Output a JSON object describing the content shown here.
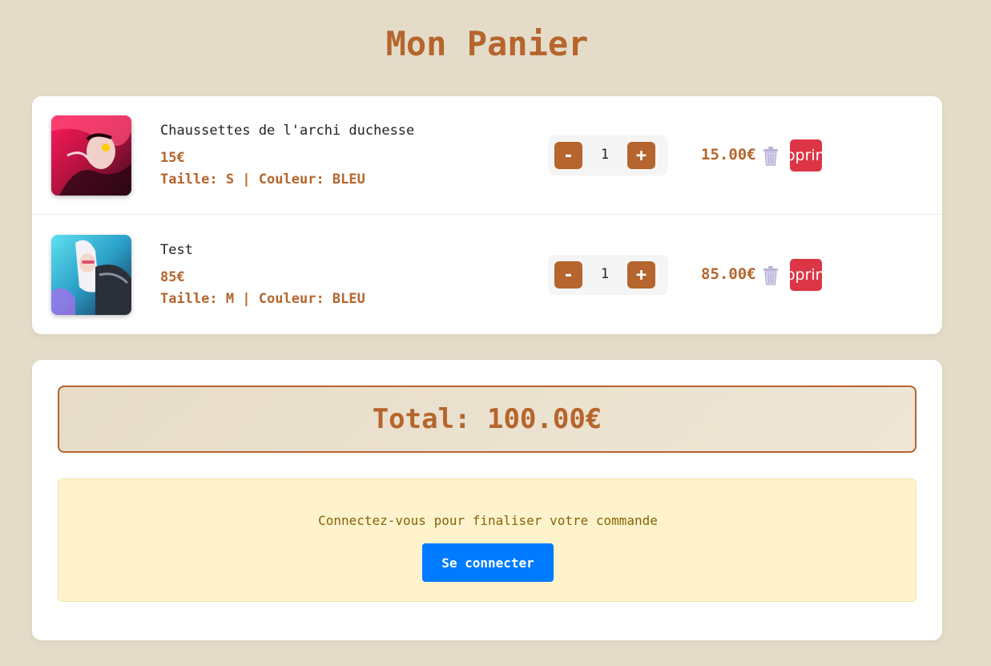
{
  "page": {
    "title": "Mon Panier"
  },
  "cart": {
    "items": [
      {
        "name": "Chaussettes de l'archi duchesse",
        "price": "15€",
        "variant": "Taille: S | Couleur: BLEU",
        "qty": "1",
        "minus_label": "-",
        "plus_label": "+",
        "line_total": "15.00€",
        "remove_label": "Supprimer",
        "image_icon": "product-image-red"
      },
      {
        "name": "Test",
        "price": "85€",
        "variant": "Taille: M | Couleur: BLEU",
        "qty": "1",
        "minus_label": "-",
        "plus_label": "+",
        "line_total": "85.00€",
        "remove_label": "Supprimer",
        "image_icon": "product-image-cyan"
      }
    ]
  },
  "summary": {
    "total": "Total: 100.00€",
    "login_message": "Connectez-vous pour finaliser votre commande",
    "login_button": "Se connecter"
  },
  "colors": {
    "background": "#e4dcc8",
    "accent": "#b5652d",
    "danger": "#dc3545",
    "primary": "#007bff",
    "warning_bg": "#fff3cd",
    "warning_text": "#856404"
  }
}
